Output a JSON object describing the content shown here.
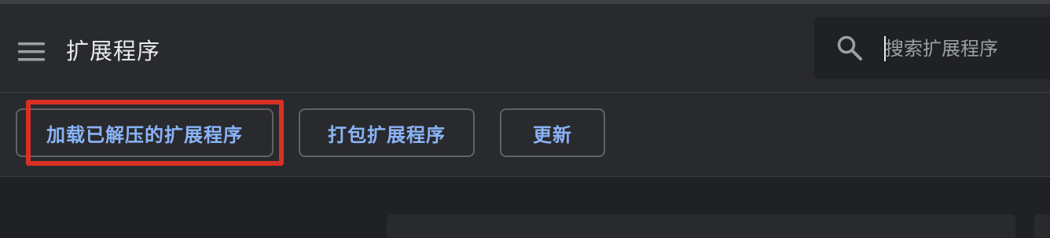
{
  "header": {
    "title": "扩展程序",
    "menu_icon": "hamburger-menu-icon",
    "search": {
      "icon": "search-icon",
      "placeholder": "搜索扩展程序",
      "value": ""
    }
  },
  "toolbar": {
    "load_unpacked_label": "加载已解压的扩展程序",
    "pack_label": "打包扩展程序",
    "update_label": "更新"
  },
  "colors": {
    "background": "#202124",
    "surface": "#292a2d",
    "accent_text": "#8ab4f8",
    "highlight": "#d93025"
  }
}
